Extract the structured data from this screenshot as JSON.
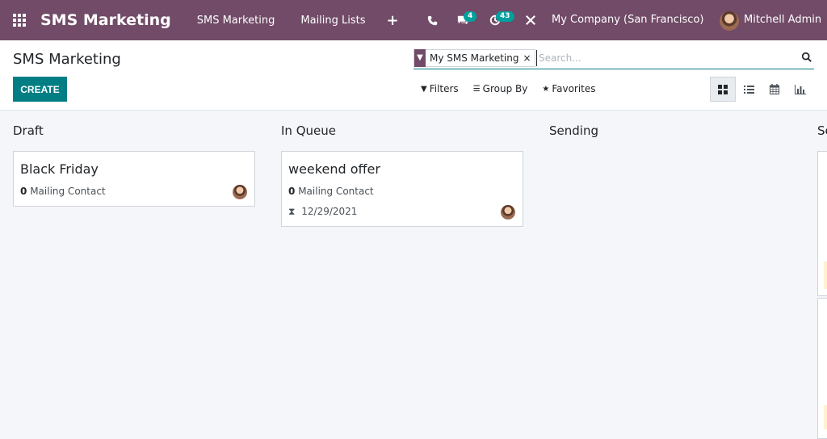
{
  "navbar": {
    "app_name": "SMS Marketing",
    "menu": [
      "SMS Marketing",
      "Mailing Lists"
    ],
    "add_icon": "plus-icon",
    "messages_count": "4",
    "activities_count": "43",
    "company": "My Company (San Francisco)",
    "user": "Mitchell Admin",
    "bg_color": "#714B67"
  },
  "control_panel": {
    "title": "SMS Marketing",
    "create_label": "CREATE",
    "search": {
      "facet": "My SMS Marketing",
      "facet_remove": "×",
      "placeholder": "Search..."
    },
    "filters_label": "Filters",
    "groupby_label": "Group By",
    "favorites_label": "Favorites",
    "views": [
      "kanban-icon",
      "list-icon",
      "calendar-icon",
      "graph-icon"
    ],
    "active_view": "kanban",
    "accent_color": "#017e84"
  },
  "kanban": {
    "columns": [
      {
        "title": "Draft",
        "cards": [
          {
            "title": "Black Friday",
            "contacts_count": "0",
            "contacts_label": "Mailing Contact"
          }
        ]
      },
      {
        "title": "In Queue",
        "cards": [
          {
            "title": "weekend offer",
            "contacts_count": "0",
            "contacts_label": "Mailing Contact",
            "scheduled_date": "12/29/2021"
          }
        ]
      },
      {
        "title": "Sending",
        "cards": []
      },
      {
        "title": "Sent",
        "cards": []
      }
    ]
  }
}
